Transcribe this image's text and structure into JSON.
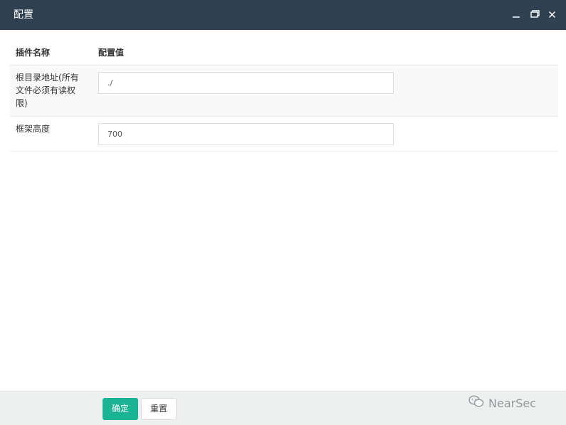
{
  "window": {
    "title": "配置"
  },
  "table": {
    "headers": {
      "name": "插件名称",
      "value": "配置值"
    },
    "rows": [
      {
        "label": "根目录地址(所有文件必须有读权限)",
        "value": "./"
      },
      {
        "label": "框架高度",
        "value": "700"
      }
    ]
  },
  "footer": {
    "ok_label": "确定",
    "reset_label": "重置"
  },
  "watermark": {
    "text": "NearSec"
  },
  "colors": {
    "titlebar": "#2f4050",
    "primary": "#1ab394",
    "footer_bg": "#eef0f0"
  }
}
